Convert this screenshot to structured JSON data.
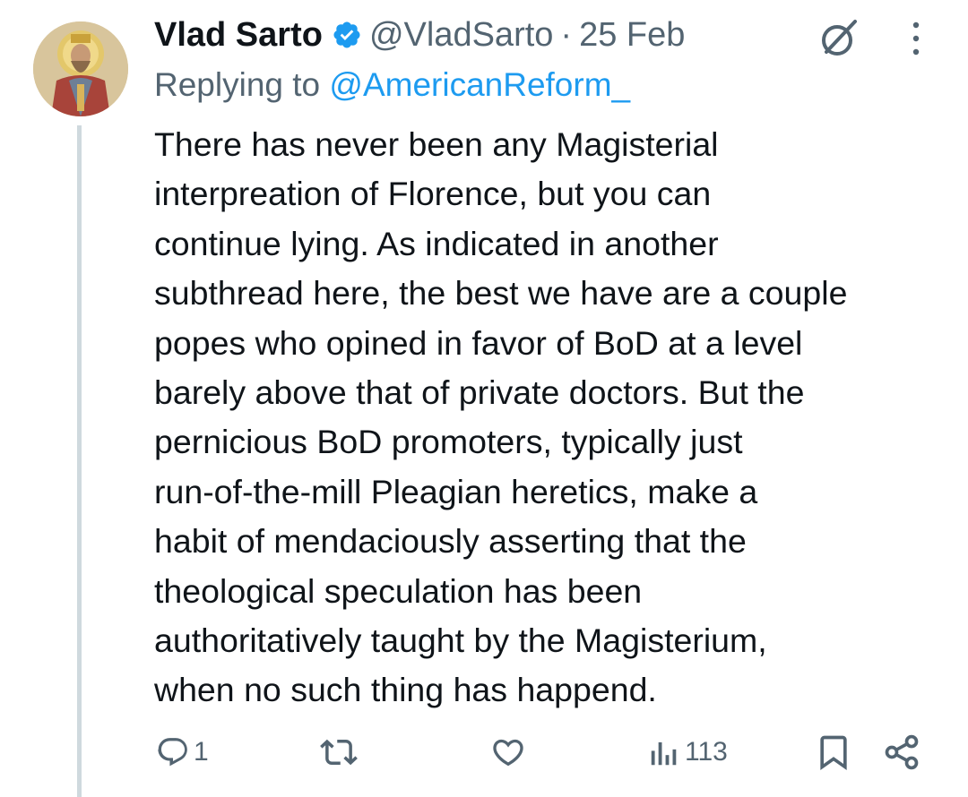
{
  "tweet": {
    "display_name": "Vlad Sarto",
    "verified": true,
    "handle": "@VladSarto",
    "separator": "·",
    "date": "25 Feb",
    "replying_prefix": "Replying to",
    "replying_to": "@AmericanReform_",
    "text": "There has never been any Magisterial\ninterpreation of Florence, but you can\ncontinue lying.  As indicated in another\nsubthread here, the best we have are a couple\npopes who opined in favor of BoD at a level\nbarely above that of private doctors.  But the\npernicious BoD promoters, typically just\nrun-of-the-mill Pleagian heretics, make a\nhabit of mendaciously asserting that the\ntheological speculation has been\nauthoritatively taught by the Magisterium,\nwhen no such thing has happend."
  },
  "actions": {
    "reply_count": "1",
    "retweet_count": "",
    "like_count": "",
    "views_count": "113"
  },
  "icons": {
    "verified": "verified-badge-icon",
    "grok": "grok-icon",
    "more": "more-vertical-icon",
    "reply": "reply-icon",
    "retweet": "retweet-icon",
    "like": "heart-icon",
    "views": "views-icon",
    "bookmark": "bookmark-icon",
    "share": "share-icon"
  },
  "colors": {
    "text": "#0f1419",
    "secondary": "#536471",
    "link": "#1d9bf0",
    "verified": "#1d9bf0",
    "thread_line": "#cfd9de"
  }
}
